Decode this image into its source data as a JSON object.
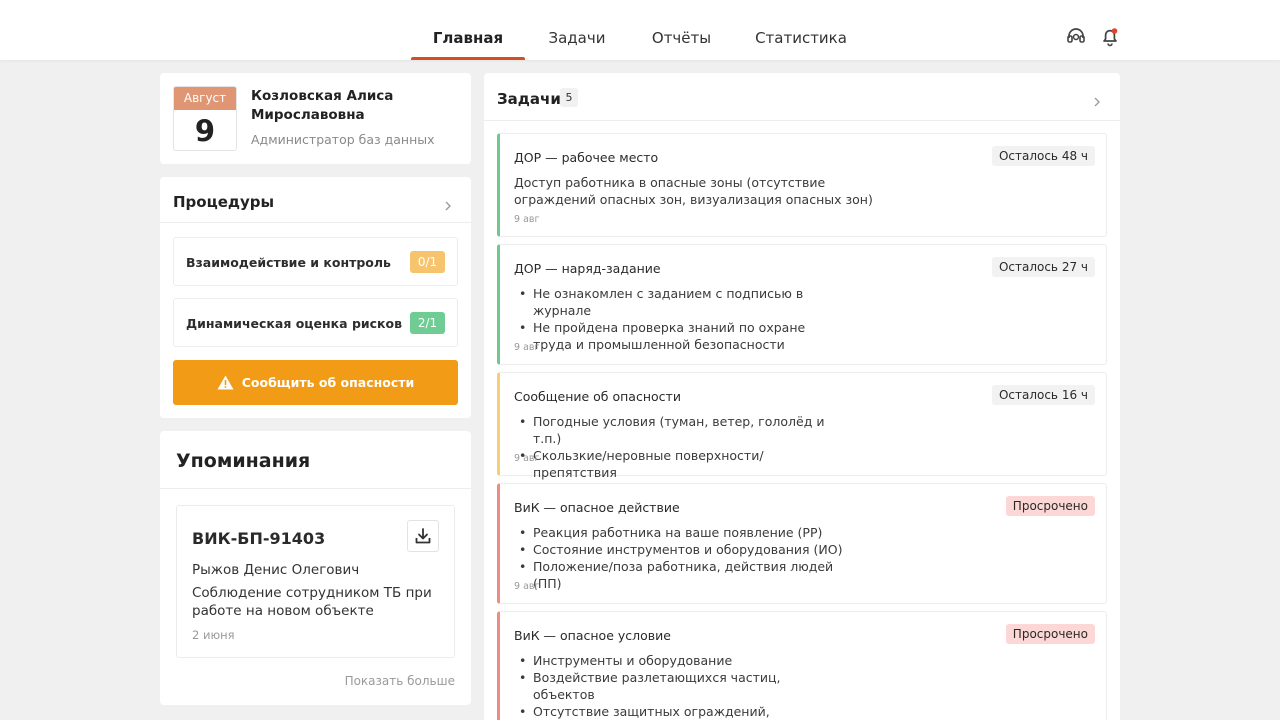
{
  "nav": {
    "items": [
      "Главная",
      "Задачи",
      "Отчёты",
      "Статистика"
    ],
    "active": 0
  },
  "header_icons": [
    "support-icon",
    "bell-icon"
  ],
  "profile": {
    "month": "Август",
    "day": "9",
    "name": "Козловская Алиса Мирославовна",
    "role": "Администратор баз данных"
  },
  "procedures": {
    "title": "Процедуры",
    "items": [
      {
        "label": "Взаимодействие и контроль",
        "badge": "0/1",
        "color": "#f7c46e"
      },
      {
        "label": "Динамическая оценка рисков",
        "badge": "2/1",
        "color": "#6fcd93"
      }
    ],
    "report_button": "Сообщить об опасности"
  },
  "mentions": {
    "title": "Упоминания",
    "card": {
      "code": "ВИК-БП-91403",
      "person": "Рыжов Денис Олегович",
      "description": "Соблюдение сотрудником ТБ при работе на новом объекте",
      "date": "2 июня"
    },
    "show_more": "Показать больше"
  },
  "tasks": {
    "title": "Задачи",
    "count": "5",
    "items": [
      {
        "title": "ДОР — рабочее место",
        "badge": "Осталось 48 ч",
        "overdue": false,
        "accent": "#6fc98f",
        "text": "Доступ работника в опасные зоны (отсутствие ограждений опасных зон, визуализация опасных зон)",
        "bullets": [],
        "date": "9 авг"
      },
      {
        "title": "ДОР — наряд-задание",
        "badge": "Осталось 27 ч",
        "overdue": false,
        "accent": "#6fc98f",
        "text": "",
        "bullets": [
          "Не ознакомлен с заданием с подписью в журнале",
          "Не пройдена проверка знаний по охране труда и промышленной безопасности"
        ],
        "date": "9 авг"
      },
      {
        "title": "Сообщение об опасности",
        "badge": "Осталось 16 ч",
        "overdue": false,
        "accent": "#f6cf75",
        "text": "",
        "bullets": [
          "Погодные условия (туман, ветер, гололёд и т.п.)",
          "Скользкие/неровные поверхности/препятствия"
        ],
        "date": "9 авг"
      },
      {
        "title": "ВиК — опасное действие",
        "badge": "Просрочено",
        "overdue": true,
        "accent": "#ef8a84",
        "text": "",
        "bullets": [
          "Реакция работника на ваше появление (РР)",
          "Состояние инструментов и оборудования (ИО)",
          "Положение/поза работника, действия людей (ПП)"
        ],
        "date": "9 авг"
      },
      {
        "title": "ВиК — опасное условие",
        "badge": "Просрочено",
        "overdue": true,
        "accent": "#ef8a84",
        "text": "",
        "bullets": [
          "Инструменты и оборудование",
          "Воздействие разлетающихся частиц, объектов",
          "Отсутствие защитных ограждений, визуального предупреждения об опасности"
        ],
        "date": ""
      }
    ]
  }
}
